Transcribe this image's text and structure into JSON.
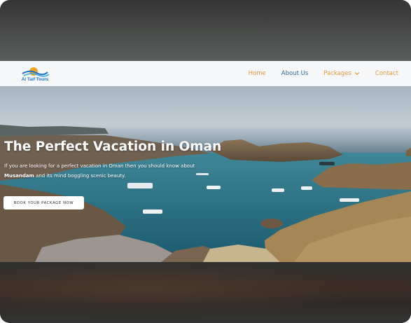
{
  "brand": {
    "logo_text": "Al Taif Tours"
  },
  "nav": {
    "items": [
      {
        "label": "Home"
      },
      {
        "label": "About Us"
      },
      {
        "label": "Packages"
      },
      {
        "label": "Contact"
      }
    ]
  },
  "hero": {
    "title": "The Perfect Vacation in Oman",
    "desc_line1": "If you are looking for a perfect vacation in Oman then you should know about",
    "desc_bold": "Musandam",
    "desc_line2": " and its mind boggling scenic beauty.",
    "cta_label": "BOOK YOUR PACKAGE NOW"
  },
  "colors": {
    "nav_accent": "#e39a3d",
    "nav_active": "#2b6a9a",
    "logo_blue": "#1e73c8",
    "logo_orange": "#f0a429"
  },
  "icons": {
    "dropdown": "chevron-down-icon"
  }
}
